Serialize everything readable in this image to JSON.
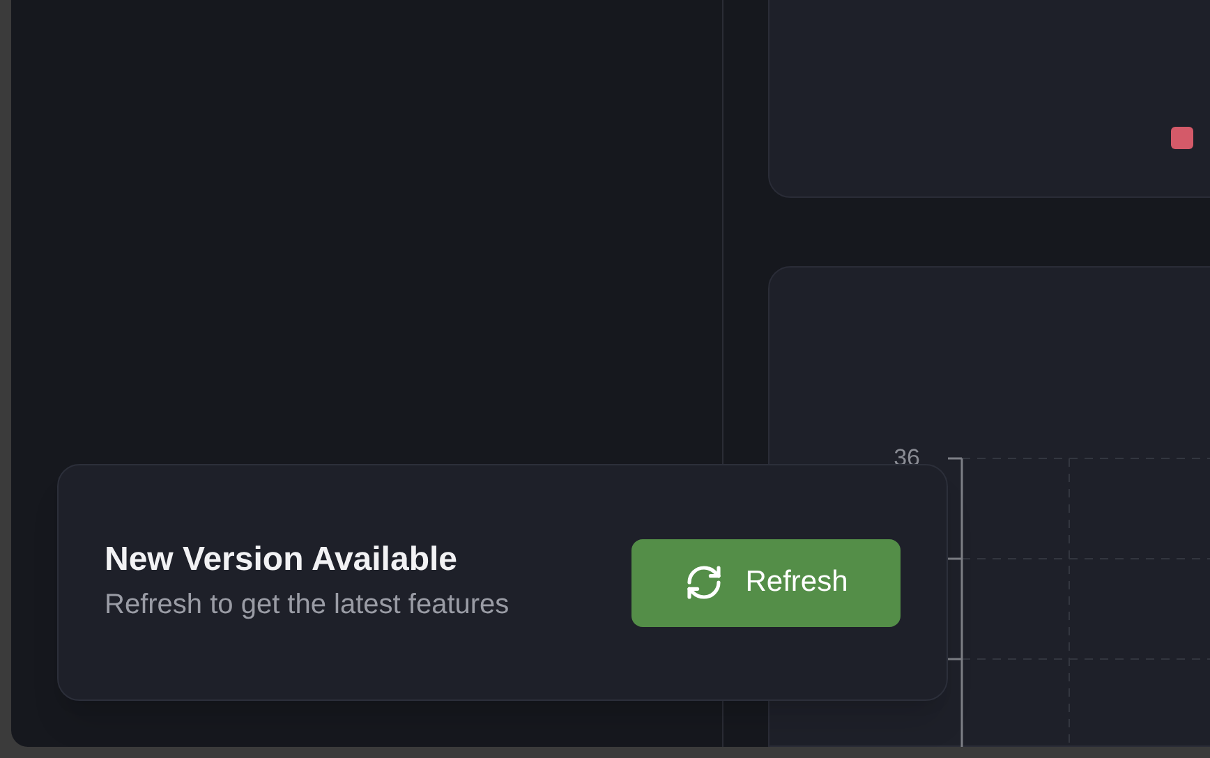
{
  "chart": {
    "y_tick_label": "36"
  },
  "toast": {
    "title": "New Version Available",
    "message": "Refresh to get the latest features",
    "button": {
      "label": "Refresh"
    }
  }
}
